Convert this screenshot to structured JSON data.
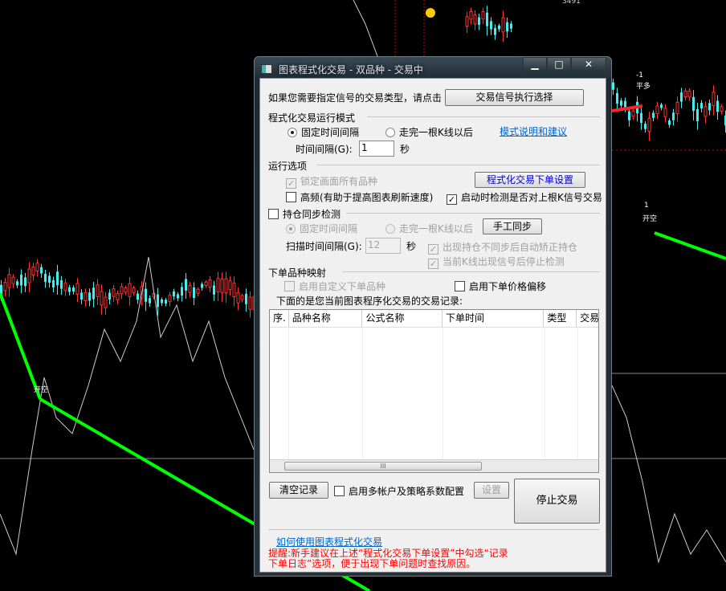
{
  "chart": {
    "labels": {
      "open_short_left": "开空",
      "open_short_right": "开空",
      "close_long": "平多",
      "minus_one": "-1",
      "one": "1",
      "top_value": "3491"
    }
  },
  "dialog": {
    "title": "图表程式化交易 - 双品种 - 交易中",
    "window_buttons": {
      "minimize": "▁",
      "maximize": "□",
      "close": "✕"
    },
    "signal_prompt": "如果您需要指定信号的交易类型，请点击",
    "signal_button": "交易信号执行选择",
    "mode_group": "程式化交易运行模式",
    "mode_fixed": "固定时间间隔",
    "mode_after_bar": "走完一根K线以后",
    "mode_help_link": "模式说明和建议",
    "interval_label": "时间间隔(G):",
    "interval_value": "1",
    "interval_unit": "秒",
    "options_group": "运行选项",
    "lock_all": "锁定画面所有品种",
    "order_settings_button": "程式化交易下单设置",
    "high_freq": "高频(有助于提高图表刷新速度)",
    "check_prev_signal": "启动时检测是否对上根K信号交易",
    "sync_group": "持仓同步检测",
    "sync_fixed": "固定时间间隔",
    "sync_after_bar": "走完一根K线以后",
    "manual_sync_button": "手工同步",
    "scan_label": "扫描时间间隔(G):",
    "scan_value": "12",
    "scan_unit": "秒",
    "auto_correct": "出现持仓不同步后自动矫正持仓",
    "stop_detect": "当前K线出现信号后停止检测",
    "mapping_group": "下单品种映射",
    "custom_symbol": "启用自定义下单品种",
    "price_offset": "启用下单价格偏移",
    "records_label": "下面的是您当前图表程序化交易的交易记录:",
    "table_headers": [
      "序.",
      "品种名称",
      "公式名称",
      "下单时间",
      "类型",
      "交易"
    ],
    "table_rows": [],
    "clear_button": "清空记录",
    "multi_account": "启用多帐户及策略系数配置",
    "settings_button": "设置",
    "stop_button": "停止交易",
    "howto_link": "如何使用图表程式化交易",
    "reminder": "提醒:新手建议在上述“程式化交易下单设置”中勾选“记录下单日志”选项，便于出现下单问题时查找原因。"
  }
}
